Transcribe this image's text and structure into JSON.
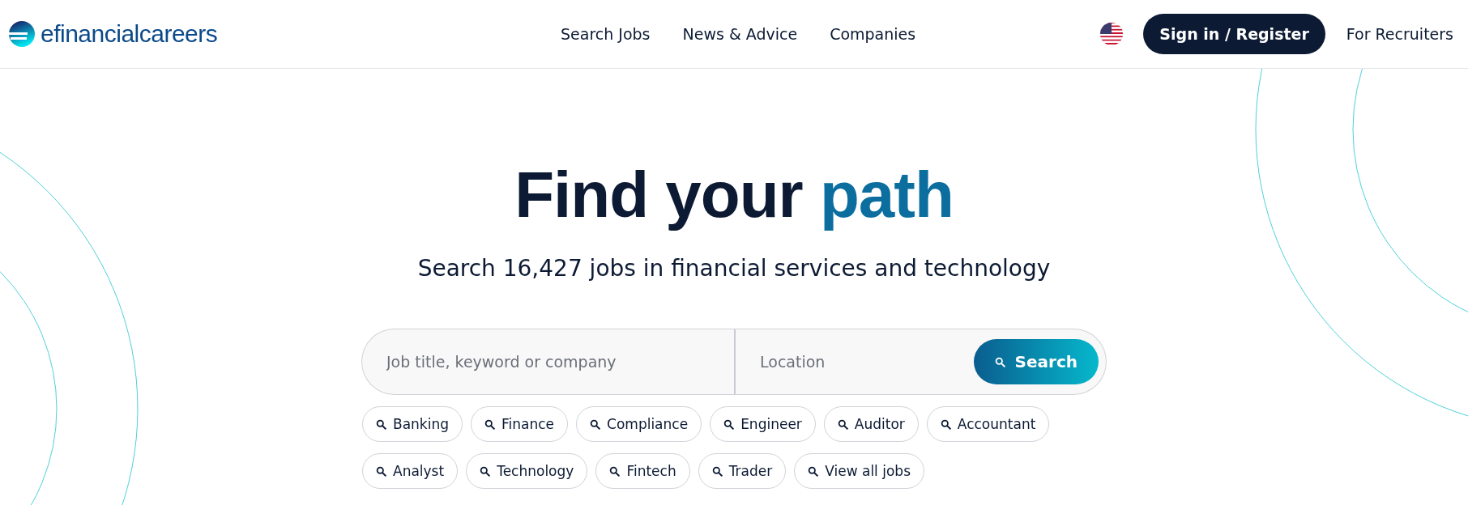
{
  "header": {
    "logo": "efinancialcareers",
    "nav": [
      "Search Jobs",
      "News & Advice",
      "Companies"
    ],
    "sign_in": "Sign in / Register",
    "recruiters": "For Recruiters"
  },
  "hero": {
    "title": "Find your",
    "title_accent": "path",
    "subtitle": "Search 16,427 jobs in financial services and technology"
  },
  "search": {
    "keyword_placeholder": "Job title, keyword or company",
    "location_placeholder": "Location",
    "button": "Search"
  },
  "chip_rows": [
    [
      "Banking",
      "Finance",
      "Compliance",
      "Engineer",
      "Auditor",
      "Accountant"
    ],
    [
      "Analyst",
      "Technology",
      "Fintech",
      "Trader",
      "View all jobs"
    ]
  ]
}
